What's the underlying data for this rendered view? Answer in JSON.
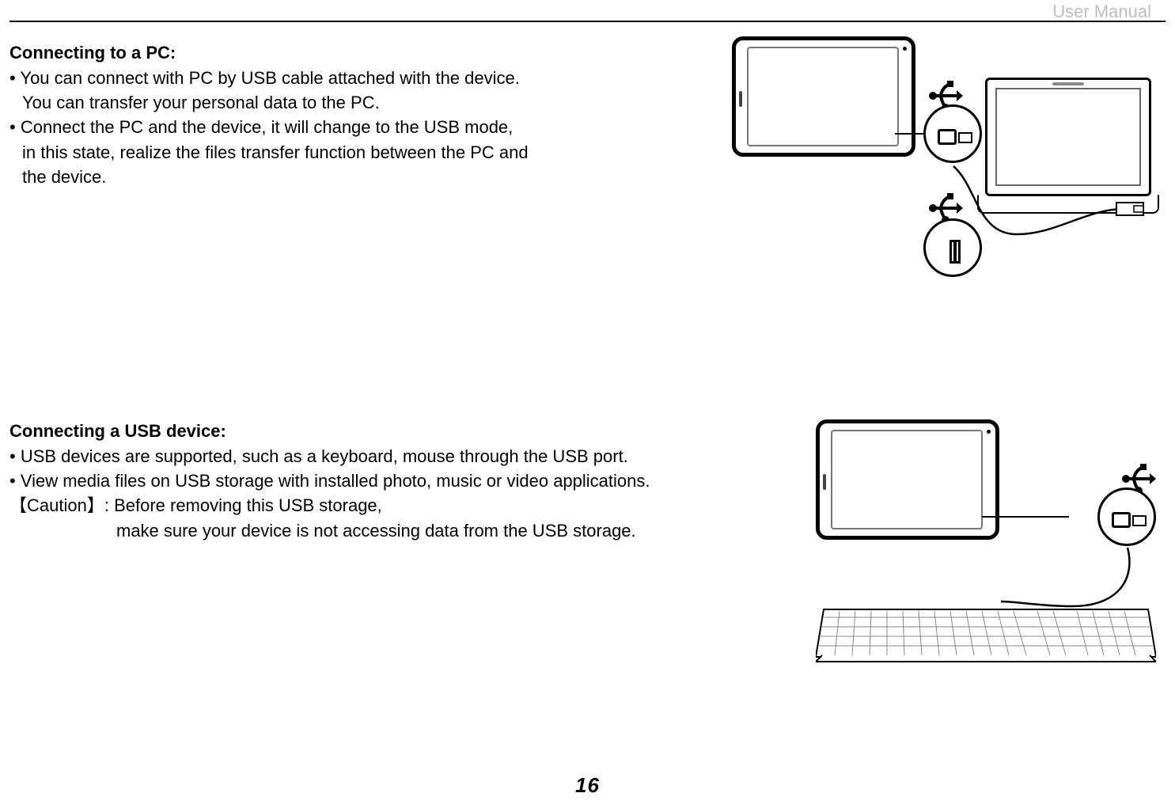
{
  "header": {
    "doc_title": "User Manual"
  },
  "section1": {
    "title": "Connecting to a PC:",
    "bullet1a": "• You can connect with PC by USB cable attached with the device.",
    "bullet1b": "You can transfer your personal data to the PC.",
    "bullet2a": "• Connect the PC and the device, it will change to the USB mode,",
    "bullet2b": "in this state, realize the files transfer function between the PC and",
    "bullet2c": "the device."
  },
  "section2": {
    "title": "Connecting a USB device:",
    "bullet1": "• USB devices are supported, such as a keyboard, mouse through the USB port.",
    "bullet2": "• View media files on USB storage with installed photo, music or video applications.",
    "caution_label": "【Caution】",
    "caution_text1": ": Before removing this USB storage,",
    "caution_text2": "make sure your device is not accessing data from the USB storage."
  },
  "page_number": "16",
  "icons": {
    "usb": "usb-icon",
    "tablet": "tablet-device",
    "laptop": "laptop-device",
    "keyboard": "keyboard-device"
  }
}
